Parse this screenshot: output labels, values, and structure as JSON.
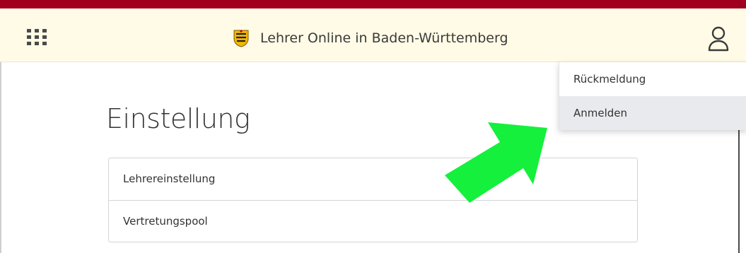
{
  "colors": {
    "top_line": "#a0001e",
    "header_bg": "#fffbe6",
    "arrow": "#14f03c",
    "dropdown_hover": "#e8eaed"
  },
  "header": {
    "apps_icon": "apps-grid-icon",
    "crest_icon": "coat-of-arms-icon",
    "title": "Lehrer Online in Baden-Württemberg",
    "user_icon": "user-icon"
  },
  "main": {
    "title": "Einstellung",
    "list": [
      {
        "label": "Lehrereinstellung"
      },
      {
        "label": "Vertretungspool"
      }
    ]
  },
  "user_menu": {
    "items": [
      {
        "label": "Rückmeldung",
        "active": false
      },
      {
        "label": "Anmelden",
        "active": true
      }
    ]
  },
  "annotation": {
    "icon": "green-arrow-icon"
  }
}
